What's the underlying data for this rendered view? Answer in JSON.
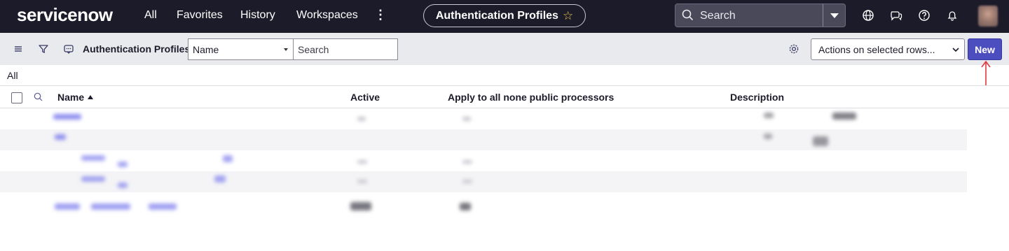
{
  "topbar": {
    "logo": "servicenow",
    "nav": [
      "All",
      "Favorites",
      "History",
      "Workspaces"
    ],
    "more_icon": "more-vertical-icon",
    "page_title": "Authentication Profiles",
    "star_icon": "star-icon",
    "search_placeholder": "Search",
    "icons": [
      "globe-icon",
      "chat-icon",
      "help-icon",
      "bell-icon"
    ],
    "colors": {
      "bar": "#1c1b2a",
      "star": "#e8c547"
    }
  },
  "toolbar": {
    "icons": [
      "menu-icon",
      "filter-icon",
      "comment-icon"
    ],
    "title": "Authentication Profiles",
    "field_select": "Name",
    "search_placeholder": "Search",
    "settings_icon": "gear-icon",
    "actions_select": "Actions on selected rows...",
    "new_label": "New",
    "colors": {
      "new_button": "#4c4ec0"
    }
  },
  "breadcrumb": "All",
  "table": {
    "columns": [
      "Name",
      "Active",
      "Apply to all none public processors",
      "Description"
    ],
    "sort": {
      "column": "Name",
      "direction": "ascending"
    },
    "visible_rows_blurred": 5
  }
}
